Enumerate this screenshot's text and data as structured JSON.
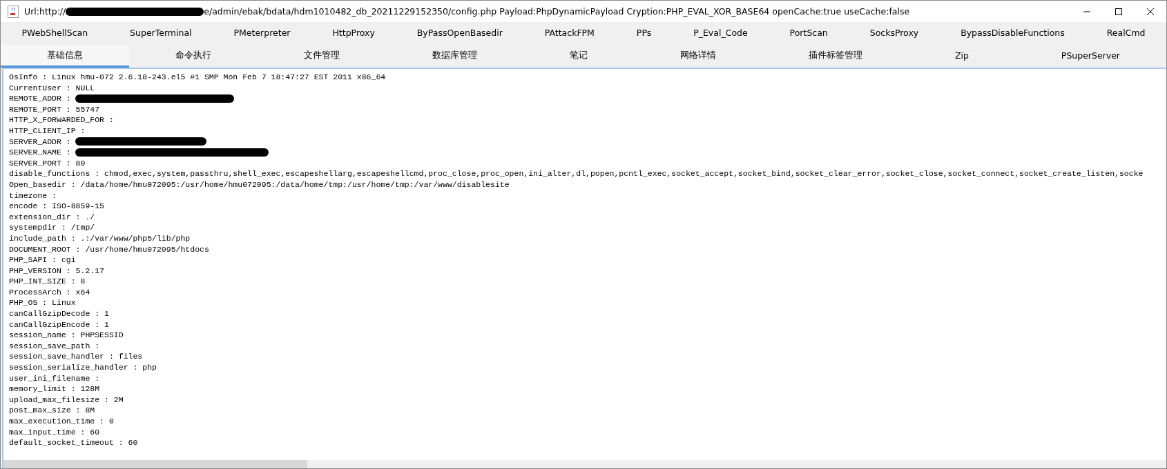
{
  "window": {
    "url_prefix": "Url:http://",
    "url_redacted": true,
    "url_rest": "e/admin/ebak/bdata/hdm1010482_db_20211229152350/config.php Payload:PhpDynamicPayload Cryption:PHP_EVAL_XOR_BASE64 openCache:true useCache:false"
  },
  "tab_rows": [
    {
      "tabs": [
        {
          "label": "PWebShellScan",
          "selected": false
        },
        {
          "label": "SuperTerminal",
          "selected": false
        },
        {
          "label": "PMeterpreter",
          "selected": false
        },
        {
          "label": "HttpProxy",
          "selected": false
        },
        {
          "label": "ByPassOpenBasedir",
          "selected": false
        },
        {
          "label": "PAttackFPM",
          "selected": false
        },
        {
          "label": "PPs",
          "selected": false
        },
        {
          "label": "P_Eval_Code",
          "selected": false
        },
        {
          "label": "PortScan",
          "selected": false
        },
        {
          "label": "SocksProxy",
          "selected": false
        },
        {
          "label": "BypassDisableFunctions",
          "selected": false
        },
        {
          "label": "RealCmd",
          "selected": false
        }
      ]
    },
    {
      "tabs": [
        {
          "label": "基础信息",
          "selected": true
        },
        {
          "label": "命令执行",
          "selected": false
        },
        {
          "label": "文件管理",
          "selected": false
        },
        {
          "label": "数据库管理",
          "selected": false
        },
        {
          "label": "笔记",
          "selected": false
        },
        {
          "label": "网络详情",
          "selected": false
        },
        {
          "label": "插件标签管理",
          "selected": false
        },
        {
          "label": "Zip",
          "selected": false
        },
        {
          "label": "PSuperServer",
          "selected": false
        }
      ]
    }
  ],
  "info_lines": [
    {
      "text": "OsInfo : Linux hmu-072 2.6.18-243.el5 #1 SMP Mon Feb 7 18:47:27 EST 2011 x86_64",
      "redacted": false
    },
    {
      "text": "CurrentUser : NULL",
      "redacted": false
    },
    {
      "text": "REMOTE_ADDR :",
      "redacted": true
    },
    {
      "text": "REMOTE_PORT : 55747",
      "redacted": false
    },
    {
      "text": "HTTP_X_FORWARDED_FOR :",
      "redacted": false
    },
    {
      "text": "HTTP_CLIENT_IP :",
      "redacted": false
    },
    {
      "text": "SERVER_ADDR :",
      "redacted": true
    },
    {
      "text": "SERVER_NAME :",
      "redacted": true
    },
    {
      "text": "SERVER_PORT : 80",
      "redacted": false
    },
    {
      "text": "disable_functions : chmod,exec,system,passthru,shell_exec,escapeshellarg,escapeshellcmd,proc_close,proc_open,ini_alter,dl,popen,pcntl_exec,socket_accept,socket_bind,socket_clear_error,socket_close,socket_connect,socket_create_listen,socke",
      "redacted": false
    },
    {
      "text": "Open_basedir : /data/home/hmu072095:/usr/home/hmu072095:/data/home/tmp:/usr/home/tmp:/var/www/disablesite",
      "redacted": false
    },
    {
      "text": "timezone :",
      "redacted": false
    },
    {
      "text": "encode : ISO-8859-15",
      "redacted": false
    },
    {
      "text": "extension_dir : ./",
      "redacted": false
    },
    {
      "text": "systempdir : /tmp/",
      "redacted": false
    },
    {
      "text": "include_path : .:/var/www/php5/lib/php",
      "redacted": false
    },
    {
      "text": "DOCUMENT_ROOT : /usr/home/hmu072095/htdocs",
      "redacted": false
    },
    {
      "text": "PHP_SAPI : cgi",
      "redacted": false
    },
    {
      "text": "PHP_VERSION : 5.2.17",
      "redacted": false
    },
    {
      "text": "PHP_INT_SIZE : 8",
      "redacted": false
    },
    {
      "text": "ProcessArch : x64",
      "redacted": false
    },
    {
      "text": "PHP_OS : Linux",
      "redacted": false
    },
    {
      "text": "canCallGzipDecode : 1",
      "redacted": false
    },
    {
      "text": "canCallGzipEncode : 1",
      "redacted": false
    },
    {
      "text": "session_name : PHPSESSID",
      "redacted": false
    },
    {
      "text": "session_save_path :",
      "redacted": false
    },
    {
      "text": "session_save_handler : files",
      "redacted": false
    },
    {
      "text": "session_serialize_handler : php",
      "redacted": false
    },
    {
      "text": "user_ini_filename :",
      "redacted": false
    },
    {
      "text": "memory_limit : 128M",
      "redacted": false
    },
    {
      "text": "upload_max_filesize : 2M",
      "redacted": false
    },
    {
      "text": "post_max_size : 8M",
      "redacted": false
    },
    {
      "text": "max_execution_time : 0",
      "redacted": false
    },
    {
      "text": "max_input_time : 60",
      "redacted": false
    },
    {
      "text": "default_socket_timeout : 60",
      "redacted": false
    }
  ]
}
